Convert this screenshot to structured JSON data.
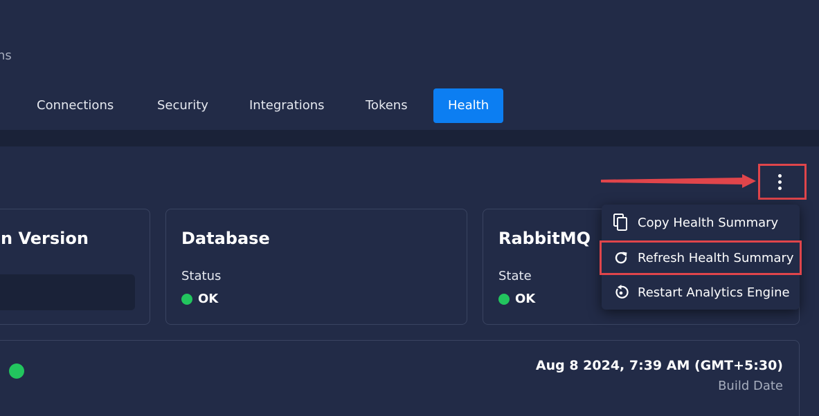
{
  "header": {
    "subtitle_fragment": "ns"
  },
  "tabs": [
    {
      "label": "Connections",
      "active": false
    },
    {
      "label": "Security",
      "active": false
    },
    {
      "label": "Integrations",
      "active": false
    },
    {
      "label": "Tokens",
      "active": false
    },
    {
      "label": "Health",
      "active": true
    }
  ],
  "cards": {
    "version": {
      "title": "n Version"
    },
    "database": {
      "title": "Database",
      "label": "Status",
      "status": "OK"
    },
    "rabbitmq": {
      "title": "RabbitMQ",
      "label": "State",
      "status": "OK"
    }
  },
  "build": {
    "date_value": "Aug 8 2024, 7:39 AM (GMT+5:30)",
    "date_label": "Build Date"
  },
  "menu": {
    "trigger_icon": "more-vertical-icon",
    "items": [
      {
        "label": "Copy Health Summary",
        "icon": "copy-icon"
      },
      {
        "label": "Refresh Health Summary",
        "icon": "refresh-icon",
        "highlighted": true
      },
      {
        "label": "Restart Analytics Engine",
        "icon": "restart-icon"
      }
    ]
  },
  "colors": {
    "background": "#222b47",
    "accent": "#0c7ef2",
    "status_ok": "#22c55e",
    "annotation": "#e0454b"
  }
}
